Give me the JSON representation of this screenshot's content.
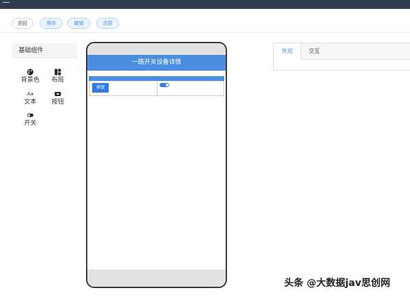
{
  "topbar": {
    "menu_icon": "menu-icon"
  },
  "toolbar": {
    "back_label": "退回",
    "save_label": "保存",
    "undo_label": "撤销",
    "redo_label": "还原"
  },
  "palette": {
    "title": "基础组件",
    "items": [
      {
        "label": "背景色",
        "icon": "palette-icon"
      },
      {
        "label": "布局",
        "icon": "layout-icon"
      },
      {
        "label": "文本",
        "icon": "text-icon",
        "glyph": "Aa"
      },
      {
        "label": "按钮",
        "icon": "button-icon"
      },
      {
        "label": "开关",
        "icon": "toggle-icon"
      }
    ]
  },
  "phone": {
    "title": "一路开关设备详情",
    "button_label": "按钮"
  },
  "properties": {
    "tabs": [
      {
        "label": "外观",
        "active": true
      },
      {
        "label": "交互",
        "active": false
      }
    ]
  },
  "watermark": "头条 @大数据jav思创网",
  "colors": {
    "accent": "#4a8ee0",
    "topbar": "#2f3a4f"
  }
}
